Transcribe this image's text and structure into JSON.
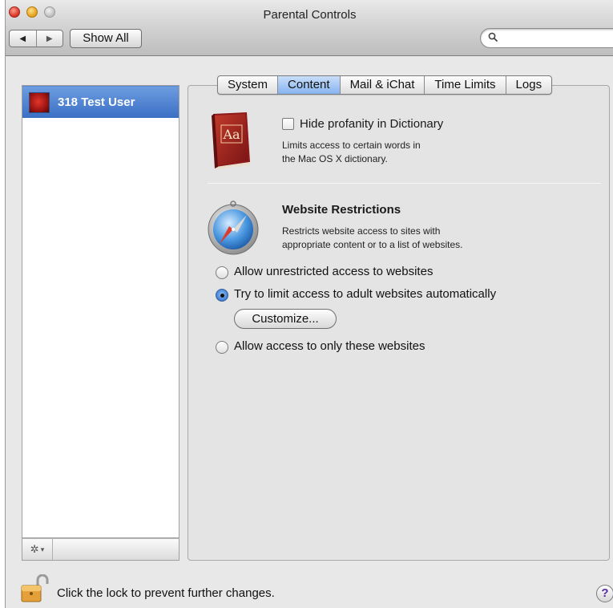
{
  "window": {
    "title": "Parental Controls"
  },
  "toolbar": {
    "back_glyph": "◀",
    "forward_glyph": "▶",
    "show_all_label": "Show All",
    "search_value": "",
    "search_placeholder": ""
  },
  "sidebar": {
    "users": [
      {
        "name": "318 Test User",
        "selected": true
      }
    ],
    "gear_glyph": "✲",
    "gear_menu_glyph": "▾"
  },
  "tabs": [
    {
      "label": "System",
      "active": false
    },
    {
      "label": "Content",
      "active": true
    },
    {
      "label": "Mail & iChat",
      "active": false
    },
    {
      "label": "Time Limits",
      "active": false
    },
    {
      "label": "Logs",
      "active": false
    }
  ],
  "dictionary": {
    "icon_text": "Aa",
    "checkbox_label": "Hide profanity in Dictionary",
    "checked": false,
    "desc_line1": "Limits access to certain words in",
    "desc_line2": "the Mac OS X dictionary."
  },
  "website": {
    "title": "Website Restrictions",
    "desc_line1": "Restricts website access to sites with",
    "desc_line2": "appropriate content or to a list of websites.",
    "options": [
      {
        "label": "Allow unrestricted access to websites",
        "selected": false
      },
      {
        "label": "Try to limit access to adult websites automatically",
        "selected": true
      },
      {
        "label": "Allow access to only these websites",
        "selected": false
      }
    ],
    "customize_label": "Customize..."
  },
  "footer": {
    "lock_text": "Click the lock to prevent further changes.",
    "help_label": "?"
  },
  "colors": {
    "selection_blue": "#3a6fc4",
    "active_tab": "#86b4ef",
    "window_bg": "#e8e8e8"
  }
}
